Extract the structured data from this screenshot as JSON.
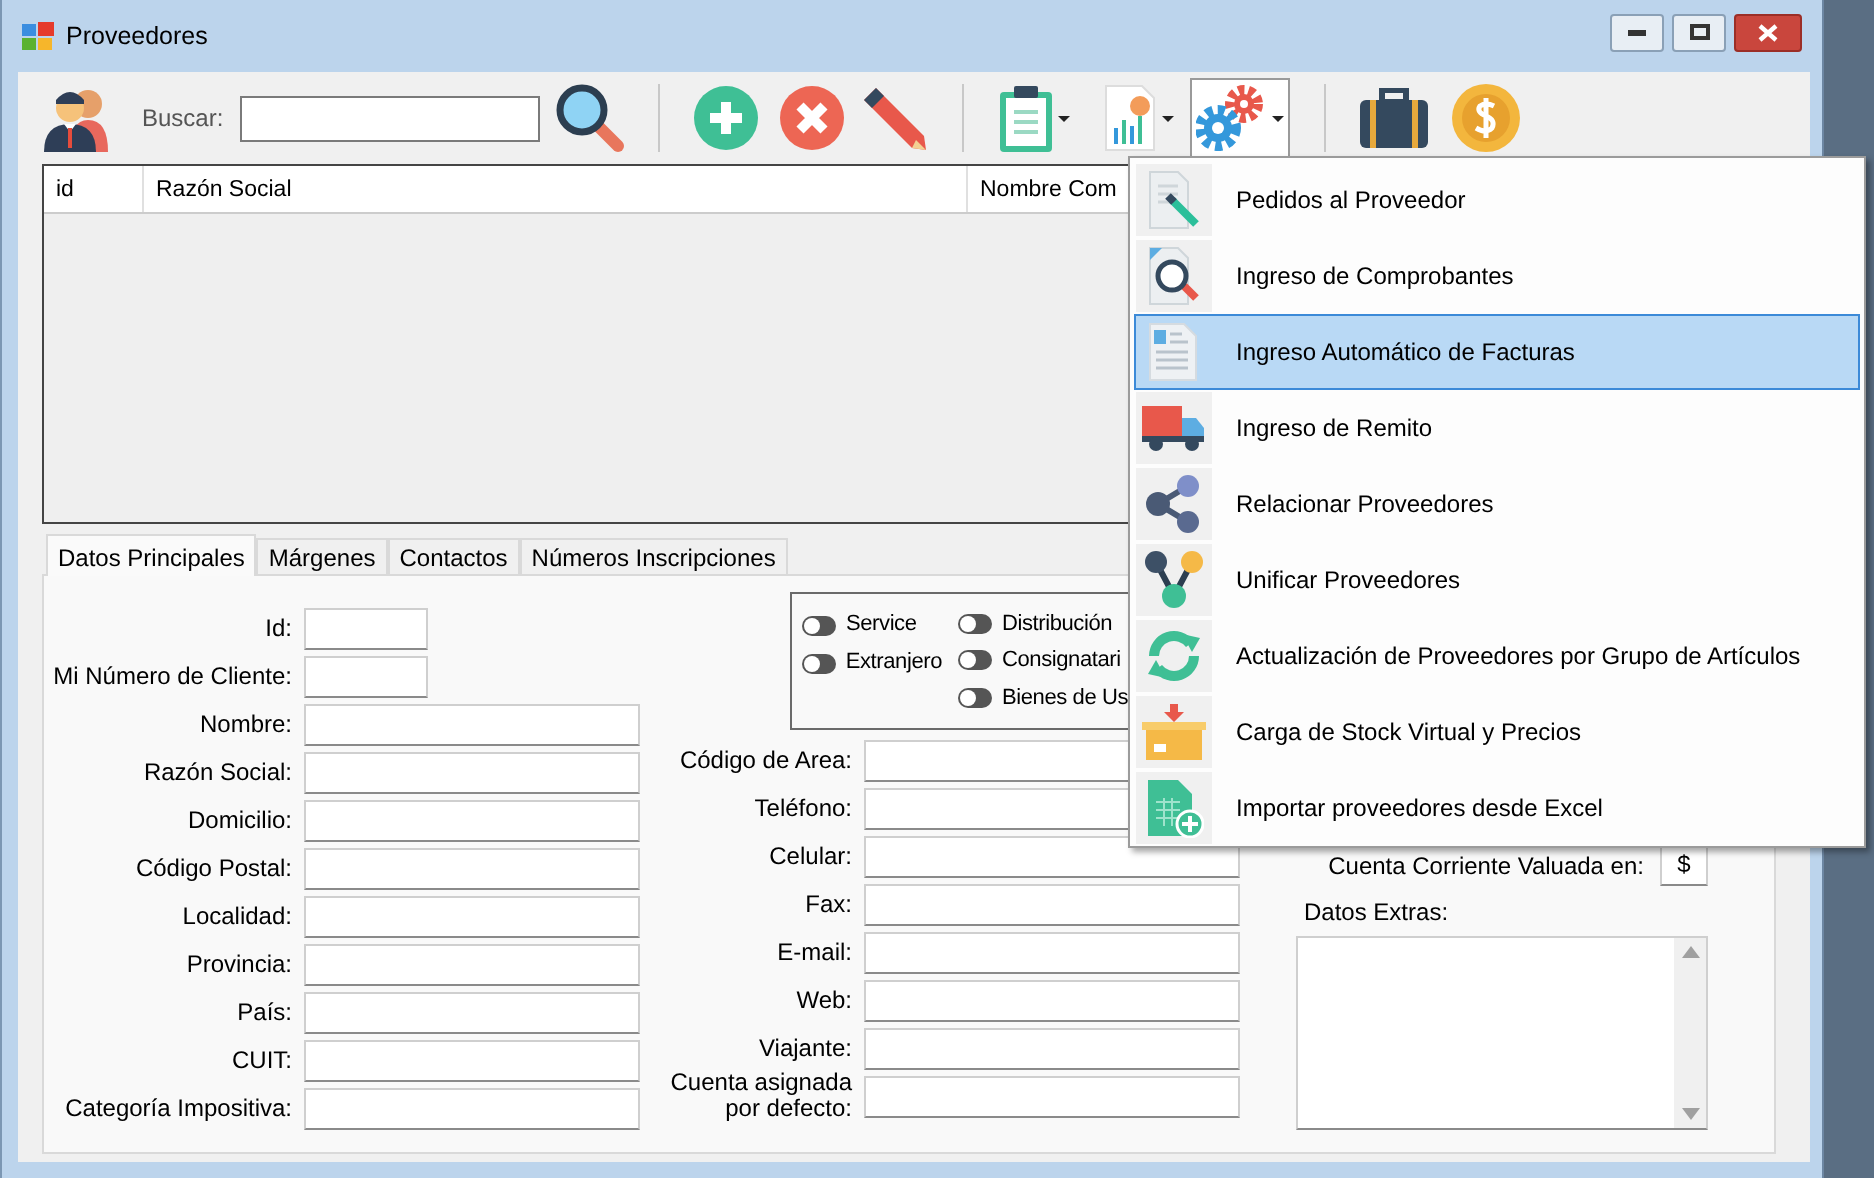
{
  "window": {
    "title": "Proveedores"
  },
  "toolbar": {
    "search_label": "Buscar:"
  },
  "settings_menu": {
    "expanded": true,
    "items": [
      {
        "label": "Pedidos al Proveedor",
        "selected": false
      },
      {
        "label": "Ingreso de Comprobantes",
        "selected": false
      },
      {
        "label": "Ingreso Automático de Facturas",
        "selected": true
      },
      {
        "label": "Ingreso de Remito",
        "selected": false
      },
      {
        "label": "Relacionar Proveedores",
        "selected": false
      },
      {
        "label": "Unificar Proveedores",
        "selected": false
      },
      {
        "label": "Actualización de Proveedores por Grupo de Artículos",
        "selected": false
      },
      {
        "label": "Carga de Stock Virtual y Precios",
        "selected": false
      },
      {
        "label": "Importar proveedores desde Excel",
        "selected": false
      }
    ]
  },
  "table": {
    "columns": [
      "id",
      "Razón Social",
      "Nombre Com"
    ]
  },
  "tabs": [
    {
      "label": "Datos Principales",
      "selected": true
    },
    {
      "label": "Márgenes",
      "selected": false
    },
    {
      "label": "Contactos",
      "selected": false
    },
    {
      "label": "Números Inscripciones",
      "selected": false
    }
  ],
  "left_fields": [
    {
      "label": "Id:",
      "kind": "short"
    },
    {
      "label": "Mi Número de Cliente:",
      "kind": "short"
    },
    {
      "label": "Nombre:",
      "kind": "long"
    },
    {
      "label": "Razón Social:",
      "kind": "long"
    },
    {
      "label": "Domicilio:",
      "kind": "long"
    },
    {
      "label": "Código Postal:",
      "kind": "long"
    },
    {
      "label": "Localidad:",
      "kind": "long"
    },
    {
      "label": "Provincia:",
      "kind": "long"
    },
    {
      "label": "País:",
      "kind": "long"
    },
    {
      "label": "CUIT:",
      "kind": "long"
    },
    {
      "label": "Categoría Impositiva:",
      "kind": "long"
    }
  ],
  "flag_columns": [
    {
      "items": [
        {
          "label": "Service",
          "on": false
        },
        {
          "label": "Extranjero",
          "on": false
        }
      ]
    },
    {
      "items": [
        {
          "label": "Distribución",
          "on": false
        },
        {
          "label": "Consignatari",
          "on": false
        },
        {
          "label": "Bienes de Us",
          "on": false
        }
      ]
    }
  ],
  "right_fields": [
    {
      "label": "Código de Area:"
    },
    {
      "label": "Teléfono:"
    },
    {
      "label": "Celular:"
    },
    {
      "label": "Fax:"
    },
    {
      "label": "E-mail:"
    },
    {
      "label": "Web:"
    },
    {
      "label": "Viajante:"
    },
    {
      "label": "Cuenta asignada por defecto:"
    }
  ],
  "currency": {
    "label": "Cuenta Corriente Valuada en:",
    "value": "$"
  },
  "extras": {
    "label": "Datos Extras:"
  }
}
